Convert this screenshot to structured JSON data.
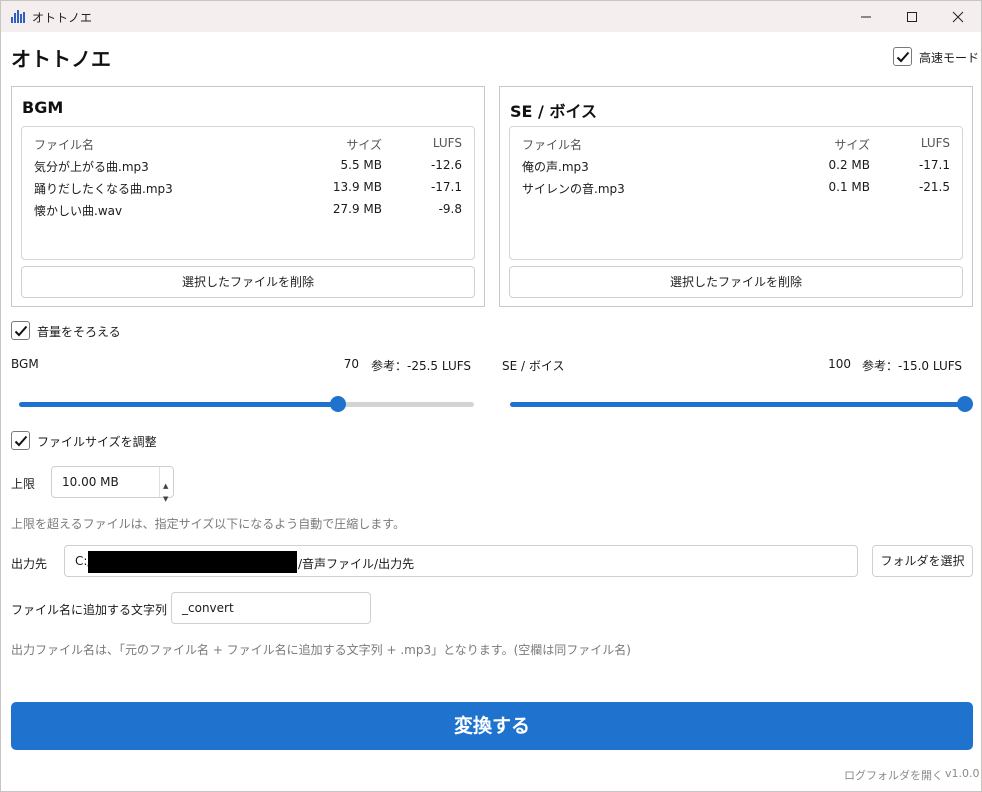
{
  "window": {
    "title": "オトトノエ",
    "controls": [
      "minimize-icon",
      "maximize-icon",
      "close-icon"
    ]
  },
  "app": {
    "heading": "オトトノエ",
    "fast_mode": {
      "label": "高速モード",
      "checked": true
    }
  },
  "bgm_panel": {
    "title": "BGM",
    "columns": {
      "name": "ファイル名",
      "size": "サイズ",
      "lufs": "LUFS"
    },
    "rows": [
      {
        "name": "気分が上がる曲.mp3",
        "size": "5.5 MB",
        "lufs": "-12.6"
      },
      {
        "name": "踊りだしたくなる曲.mp3",
        "size": "13.9 MB",
        "lufs": "-17.1"
      },
      {
        "name": "懐かしい曲.wav",
        "size": "27.9 MB",
        "lufs": "-9.8"
      }
    ],
    "delete_button": "選択したファイルを削除"
  },
  "se_panel": {
    "title": "SE / ボイス",
    "columns": {
      "name": "ファイル名",
      "size": "サイズ",
      "lufs": "LUFS"
    },
    "rows": [
      {
        "name": "俺の声.mp3",
        "size": "0.2 MB",
        "lufs": "-17.1"
      },
      {
        "name": "サイレンの音.mp3",
        "size": "0.1 MB",
        "lufs": "-21.5"
      }
    ],
    "delete_button": "選択したファイルを削除"
  },
  "normalize": {
    "label": "音量をそろえる",
    "checked": true,
    "bgm": {
      "label": "BGM",
      "value_text": "70",
      "ref_text": "参考：-25.5 LUFS",
      "value": 70,
      "max": 100
    },
    "se": {
      "label": "SE / ボイス",
      "value_text": "100",
      "ref_text": "参考：-15.0 LUFS",
      "value": 100,
      "max": 100
    }
  },
  "filesize": {
    "label": "ファイルサイズを調整",
    "checked": true,
    "limit_label": "上限",
    "limit_value": "10.00 MB",
    "hint": "上限を超えるファイルは、指定サイズ以下になるよう自動で圧縮します。"
  },
  "output": {
    "label": "出力先",
    "path_prefix": "C:/",
    "path_suffix": "/音声ファイル/出力先",
    "browse_button": "フォルダを選択",
    "suffix_label": "ファイル名に追加する文字列",
    "suffix_value": "_convert",
    "hint": "出力ファイル名は、「元のファイル名 + ファイル名に追加する文字列 + .mp3」となります。(空欄は同ファイル名)"
  },
  "convert_button": "変換する",
  "footer": {
    "log_link": "ログフォルダを開く",
    "version": "v1.0.0"
  },
  "colors": {
    "accent": "#1f73cf",
    "titlebar": "#f5eeee"
  }
}
